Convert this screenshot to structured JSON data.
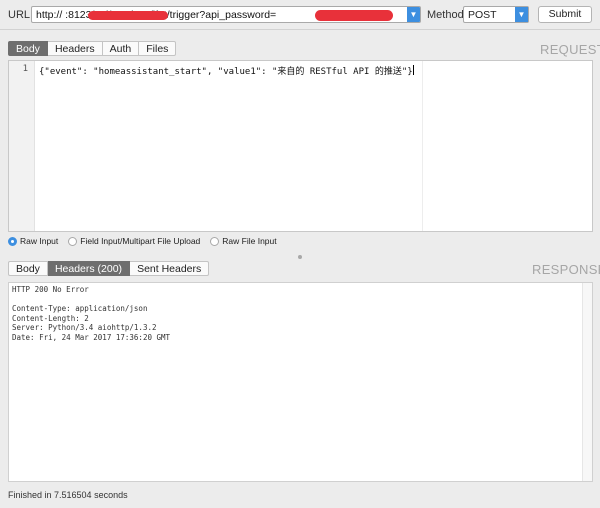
{
  "topbar": {
    "url_label": "URL:",
    "url_value": "http://                 :8123/api/services/ifttt/trigger?api_password=",
    "method_label": "Method:",
    "method_value": "POST",
    "submit_label": "Submit"
  },
  "request": {
    "title": "REQUEST",
    "tabs": [
      "Body",
      "Headers",
      "Auth",
      "Files"
    ],
    "active_tab": "Body",
    "line_number": "1",
    "body_text": "{\"event\": \"homeassistant_start\", \"value1\": \"来自的 RESTful API 的推送\"}",
    "input_modes": [
      "Raw Input",
      "Field Input/Multipart File Upload",
      "Raw File Input"
    ],
    "selected_mode": "Raw Input"
  },
  "response": {
    "title": "RESPONSE",
    "tabs": [
      "Body",
      "Headers (200)",
      "Sent Headers"
    ],
    "active_tab": "Headers (200)",
    "headers_text": "HTTP 200 No Error\n\nContent-Type: application/json\nContent-Length: 2\nServer: Python/3.4 aiohttp/1.3.2\nDate: Fri, 24 Mar 2017 17:36:20 GMT"
  },
  "status": {
    "finished_text": "Finished in 7.516504 seconds"
  },
  "colors": {
    "accent": "#3d8fe0",
    "active_tab": "#6e6e6e",
    "redaction": "#e8313a",
    "background": "#ececec"
  }
}
